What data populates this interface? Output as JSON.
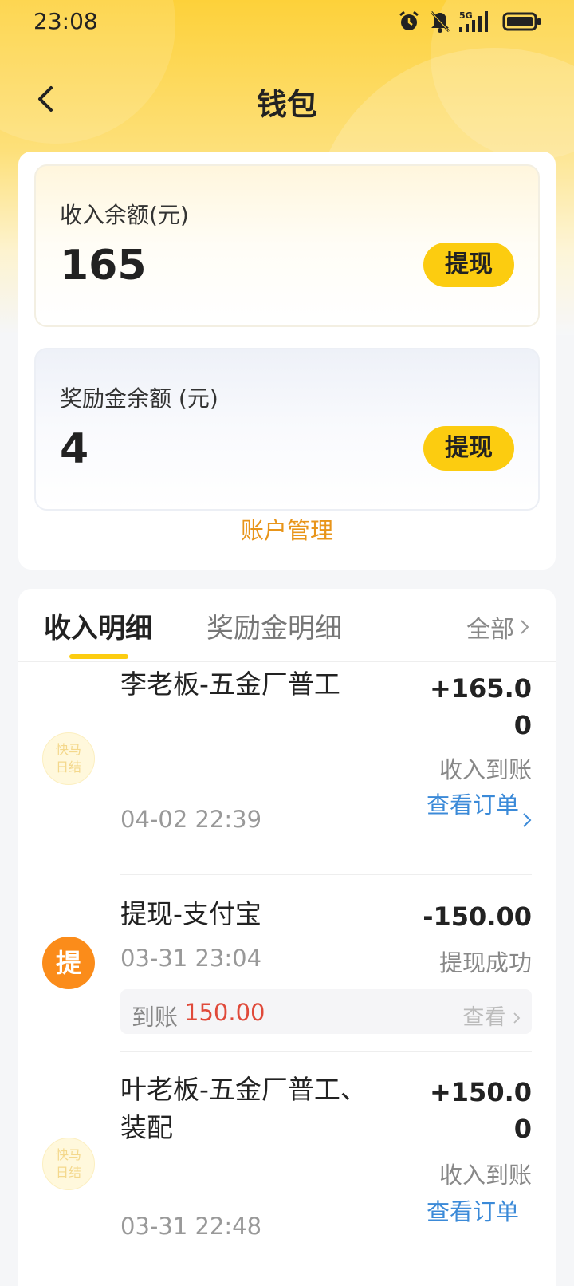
{
  "status_bar": {
    "time": "23:08",
    "network": "5G",
    "icons": [
      "alarm-icon",
      "mute-bell-icon",
      "signal-icon",
      "battery-icon"
    ]
  },
  "header": {
    "title": "钱包",
    "back_icon": "chevron-left-icon"
  },
  "wallet": {
    "income_label": "收入余额(元)",
    "income_amount": "165",
    "reward_label": "奖励金余额 (元)",
    "reward_amount": "4",
    "withdraw_label": "提现",
    "account_management": "账户管理",
    "accent_color": "#fccc10",
    "link_color": "#e8951a"
  },
  "details": {
    "tabs": [
      {
        "label": "收入明细",
        "active": true
      },
      {
        "label": "奖励金明细",
        "active": false
      }
    ],
    "filter_label": "全部",
    "records": [
      {
        "icon": "kuaima-logo",
        "logo_text": "快马\n日结",
        "title": "李老板-五金厂普工",
        "amount": "+165.00",
        "status": "收入到账",
        "time": "04-02 22:39",
        "link": "查看订单"
      },
      {
        "icon": "withdraw-badge",
        "badge_text": "提",
        "title": "提现-支付宝",
        "amount": "-150.00",
        "status": "提现成功",
        "time": "03-31 23:04",
        "arrival_label": "到账",
        "arrival_value": "150.00",
        "view_label": "查看"
      },
      {
        "icon": "kuaima-logo",
        "logo_text": "快马\n日结",
        "title": "叶老板-五金厂普工、装配",
        "amount": "+150.00",
        "status": "收入到账",
        "time": "03-31 22:48",
        "link": "查看订单"
      }
    ]
  }
}
